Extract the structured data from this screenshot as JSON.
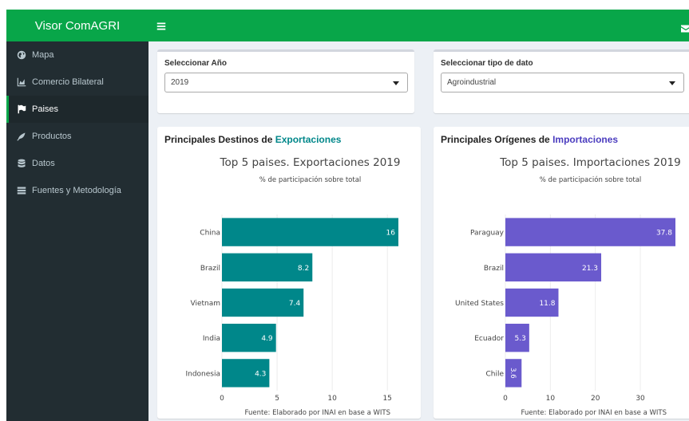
{
  "app": {
    "title": "Visor ComAGRI"
  },
  "colors": {
    "brand": "#08a649",
    "sidebar": "#222d32",
    "export_bar": "#00878a",
    "import_bar": "#6a5acd",
    "export_accent": "#00878a",
    "import_accent": "#4b3dbf"
  },
  "sidebar": {
    "items": [
      {
        "label": "Mapa",
        "icon": "globe-icon"
      },
      {
        "label": "Comercio Bilateral",
        "icon": "area-chart-icon"
      },
      {
        "label": "Paises",
        "icon": "flag-icon",
        "active": true
      },
      {
        "label": "Productos",
        "icon": "leaf-icon"
      },
      {
        "label": "Datos",
        "icon": "database-icon"
      },
      {
        "label": "Fuentes y Metodología",
        "icon": "list-icon"
      }
    ]
  },
  "filters": {
    "year": {
      "label": "Seleccionar Año",
      "value": "2019"
    },
    "data_type": {
      "label": "Seleccionar tipo de dato",
      "value": "Agroindustrial"
    }
  },
  "exports_panel": {
    "heading_prefix": "Principales Destinos de ",
    "heading_highlight": "Exportaciones"
  },
  "imports_panel": {
    "heading_prefix": "Principales Orígenes de ",
    "heading_highlight": "Importaciones"
  },
  "chart_data": [
    {
      "type": "bar",
      "orientation": "horizontal",
      "title": "Top 5 paises. Exportaciones 2019",
      "subtitle": "% de participación sobre total",
      "caption": "Fuente: Elaborado por INAI en base a WITS",
      "categories": [
        "China",
        "Brazil",
        "Vietnam",
        "India",
        "Indonesia"
      ],
      "values": [
        16,
        8.2,
        7.4,
        4.9,
        4.3
      ],
      "xlim": [
        0,
        16
      ],
      "xticks": [
        0,
        5,
        10,
        15
      ],
      "grid": true,
      "color": "#00878a"
    },
    {
      "type": "bar",
      "orientation": "horizontal",
      "title": "Top 5 paises. Importaciones 2019",
      "subtitle": "% de participación sobre total",
      "caption": "Fuente: Elaborado por INAI en base a WITS",
      "categories": [
        "Paraguay",
        "Brazil",
        "United States",
        "Ecuador",
        "Chile"
      ],
      "values": [
        37.8,
        21.3,
        11.8,
        5.3,
        3.6
      ],
      "xlim": [
        0,
        37.8
      ],
      "xticks": [
        0,
        10,
        20,
        30
      ],
      "grid": true,
      "color": "#6a5acd"
    }
  ]
}
